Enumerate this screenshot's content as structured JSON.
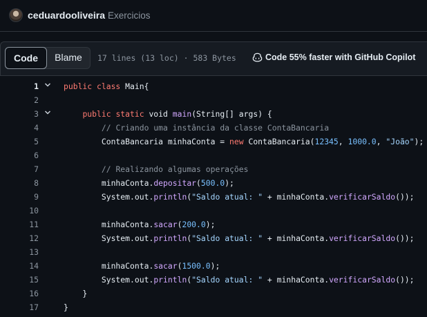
{
  "repo": {
    "owner": "ceduardooliveira",
    "name": "Exercicios"
  },
  "file_header": {
    "tabs": [
      "Code",
      "Blame"
    ],
    "active_tab": "Code",
    "meta": "17 lines (13 loc) · 583 Bytes",
    "copilot": "Code 55% faster with GitHub Copilot"
  },
  "colors": {
    "background": "#0d1117",
    "keyword": "#ff7b72",
    "function": "#d2a8ff",
    "number": "#79c0ff",
    "string": "#a5d6ff",
    "comment": "#8b949e"
  },
  "code_lines": [
    {
      "n": "1",
      "fold": true,
      "tokens": [
        [
          "kw",
          "public class "
        ],
        [
          "pl",
          "Main{"
        ]
      ]
    },
    {
      "n": "2",
      "fold": false,
      "tokens": []
    },
    {
      "n": "3",
      "fold": true,
      "tokens": [
        [
          "pl",
          "    "
        ],
        [
          "kw",
          "public static "
        ],
        [
          "pl",
          "void "
        ],
        [
          "fn",
          "main"
        ],
        [
          "pl",
          "(String[] args) {"
        ]
      ]
    },
    {
      "n": "4",
      "fold": false,
      "tokens": [
        [
          "pl",
          "        "
        ],
        [
          "cm",
          "// Criando uma instância da classe ContaBancaria"
        ]
      ]
    },
    {
      "n": "5",
      "fold": false,
      "tokens": [
        [
          "pl",
          "        ContaBancaria minhaConta = "
        ],
        [
          "kw",
          "new "
        ],
        [
          "pl",
          "ContaBancaria("
        ],
        [
          "num",
          "12345"
        ],
        [
          "pl",
          ", "
        ],
        [
          "num",
          "1000.0"
        ],
        [
          "pl",
          ", "
        ],
        [
          "str",
          "\"João\""
        ],
        [
          "pl",
          ");"
        ]
      ]
    },
    {
      "n": "6",
      "fold": false,
      "tokens": []
    },
    {
      "n": "7",
      "fold": false,
      "tokens": [
        [
          "pl",
          "        "
        ],
        [
          "cm",
          "// Realizando algumas operações"
        ]
      ]
    },
    {
      "n": "8",
      "fold": false,
      "tokens": [
        [
          "pl",
          "        minhaConta."
        ],
        [
          "fn",
          "depositar"
        ],
        [
          "pl",
          "("
        ],
        [
          "num",
          "500.0"
        ],
        [
          "pl",
          ");"
        ]
      ]
    },
    {
      "n": "9",
      "fold": false,
      "tokens": [
        [
          "pl",
          "        System.out."
        ],
        [
          "fn",
          "println"
        ],
        [
          "pl",
          "("
        ],
        [
          "str",
          "\"Saldo atual: \""
        ],
        [
          "pl",
          " + minhaConta."
        ],
        [
          "fn",
          "verificarSaldo"
        ],
        [
          "pl",
          "());"
        ]
      ]
    },
    {
      "n": "10",
      "fold": false,
      "tokens": []
    },
    {
      "n": "11",
      "fold": false,
      "tokens": [
        [
          "pl",
          "        minhaConta."
        ],
        [
          "fn",
          "sacar"
        ],
        [
          "pl",
          "("
        ],
        [
          "num",
          "200.0"
        ],
        [
          "pl",
          ");"
        ]
      ]
    },
    {
      "n": "12",
      "fold": false,
      "tokens": [
        [
          "pl",
          "        System.out."
        ],
        [
          "fn",
          "println"
        ],
        [
          "pl",
          "("
        ],
        [
          "str",
          "\"Saldo atual: \""
        ],
        [
          "pl",
          " + minhaConta."
        ],
        [
          "fn",
          "verificarSaldo"
        ],
        [
          "pl",
          "());"
        ]
      ]
    },
    {
      "n": "13",
      "fold": false,
      "tokens": []
    },
    {
      "n": "14",
      "fold": false,
      "tokens": [
        [
          "pl",
          "        minhaConta."
        ],
        [
          "fn",
          "sacar"
        ],
        [
          "pl",
          "("
        ],
        [
          "num",
          "1500.0"
        ],
        [
          "pl",
          ");"
        ]
      ]
    },
    {
      "n": "15",
      "fold": false,
      "tokens": [
        [
          "pl",
          "        System.out."
        ],
        [
          "fn",
          "println"
        ],
        [
          "pl",
          "("
        ],
        [
          "str",
          "\"Saldo atual: \""
        ],
        [
          "pl",
          " + minhaConta."
        ],
        [
          "fn",
          "verificarSaldo"
        ],
        [
          "pl",
          "());"
        ]
      ]
    },
    {
      "n": "16",
      "fold": false,
      "tokens": [
        [
          "pl",
          "    }"
        ]
      ]
    },
    {
      "n": "17",
      "fold": false,
      "tokens": [
        [
          "pl",
          "}"
        ]
      ]
    }
  ]
}
